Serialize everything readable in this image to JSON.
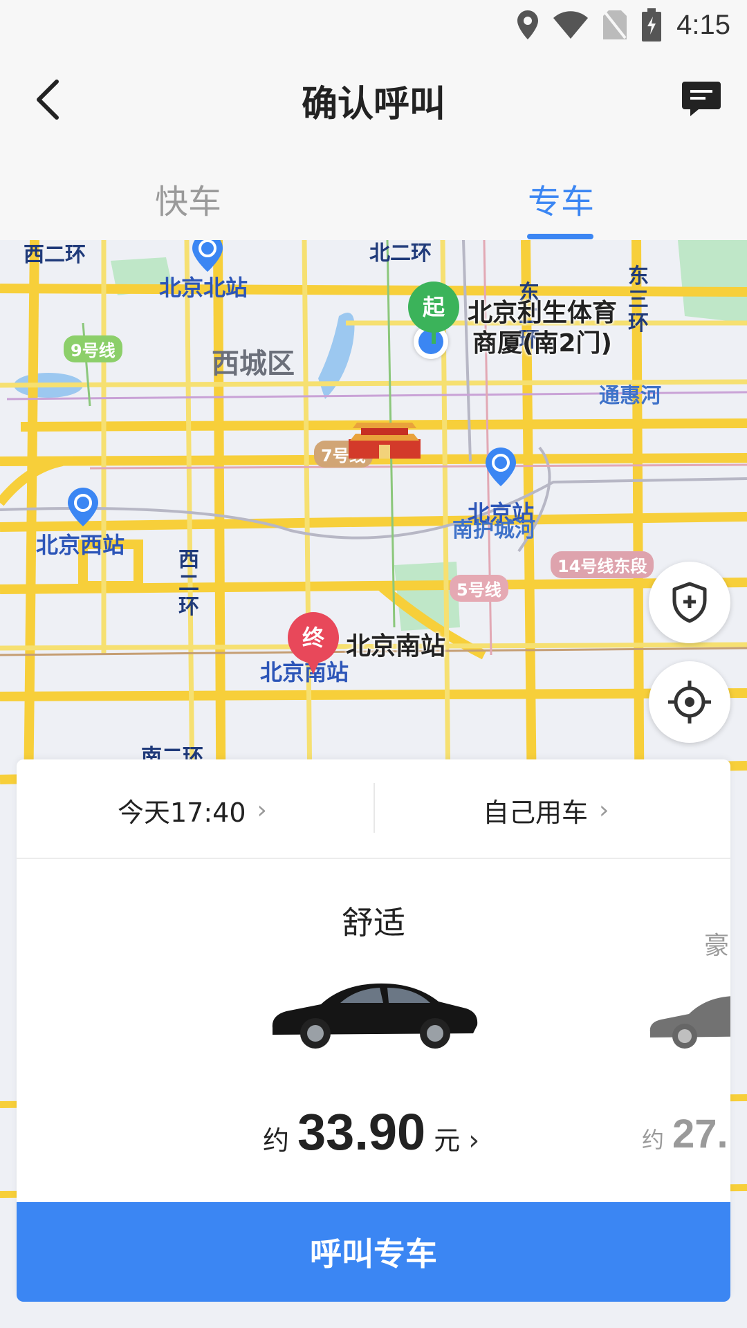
{
  "status_bar": {
    "time": "4:15"
  },
  "header": {
    "title": "确认呼叫"
  },
  "tabs": [
    {
      "label": "快车",
      "active": false
    },
    {
      "label": "专车",
      "active": true
    }
  ],
  "map": {
    "start_pin": "起",
    "end_pin": "终",
    "start_place": "北京利生体育商厦(南2门)",
    "start_place_line1": "北京利生体育",
    "start_place_line2": "商厦(南2门)",
    "end_place": "北京南站",
    "labels": {
      "west_2nd_ring": "西二环",
      "north_2nd_ring": "北二环",
      "east_2nd_ring": "东二环",
      "east_3rd_ring": "东三环",
      "west_2nd_ring_lower": "西二环",
      "south_2nd_ring": "南二环",
      "beijing_north": "北京北站",
      "beijing_west": "北京西站",
      "beijing_station": "北京站",
      "beijing_south": "北京南站",
      "xicheng": "西城区",
      "tonghui_river": "通惠河",
      "nanhu_river": "南护城河",
      "line9": "9号线",
      "line7": "7号线",
      "line5": "5号线",
      "line14": "14号线东段"
    }
  },
  "options": {
    "time": "今天17:40",
    "rider": "自己用车"
  },
  "cars": [
    {
      "name": "舒适",
      "approx": "约",
      "price": "33.90",
      "unit": "元"
    },
    {
      "name": "豪",
      "approx": "约",
      "price": "27."
    }
  ],
  "call_button": "呼叫专车",
  "colors": {
    "accent": "#3b86f3",
    "start_pin": "#3bb35a",
    "end_pin": "#e8485a"
  }
}
